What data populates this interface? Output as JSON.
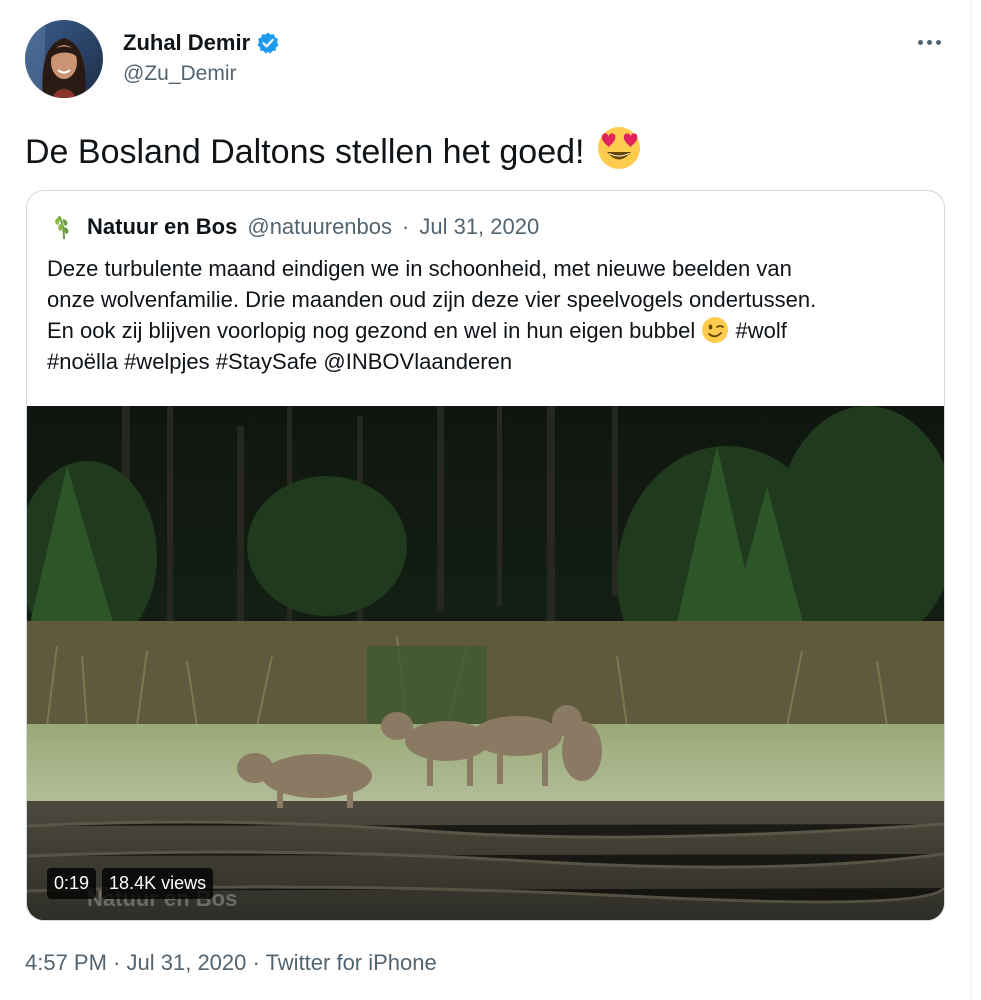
{
  "author": {
    "name": "Zuhal Demir",
    "handle": "@Zu_Demir",
    "verified": true
  },
  "tweet": {
    "text": "De Bosland Daltons stellen het goed!",
    "emoji": "heart-eyes-emoji"
  },
  "quoted_tweet": {
    "name": "Natuur en Bos",
    "handle": "@natuurenbos",
    "separator": "·",
    "date": "Jul 31, 2020",
    "lines": [
      "Deze turbulente maand eindigen we in schoonheid, met nieuwe beelden van",
      "onze wolvenfamilie. Drie maanden oud zijn deze vier speelvogels ondertussen.",
      "En ook zij blijven voorlopig nog gezond en wel in hun eigen bubbel",
      "#noëlla #welpjes #StaySafe @INBOVlaanderen"
    ],
    "line3_suffix": "#wolf",
    "video": {
      "duration": "0:19",
      "views": "18.4K views",
      "watermark": "Natuur en Bos"
    }
  },
  "meta": {
    "time": "4:57 PM",
    "separator": "·",
    "date": "Jul 31, 2020",
    "source": "Twitter for iPhone"
  },
  "colors": {
    "text": "#0f1419",
    "secondary": "#536471",
    "verified": "#1d9bf0",
    "border": "#cfd9de"
  }
}
